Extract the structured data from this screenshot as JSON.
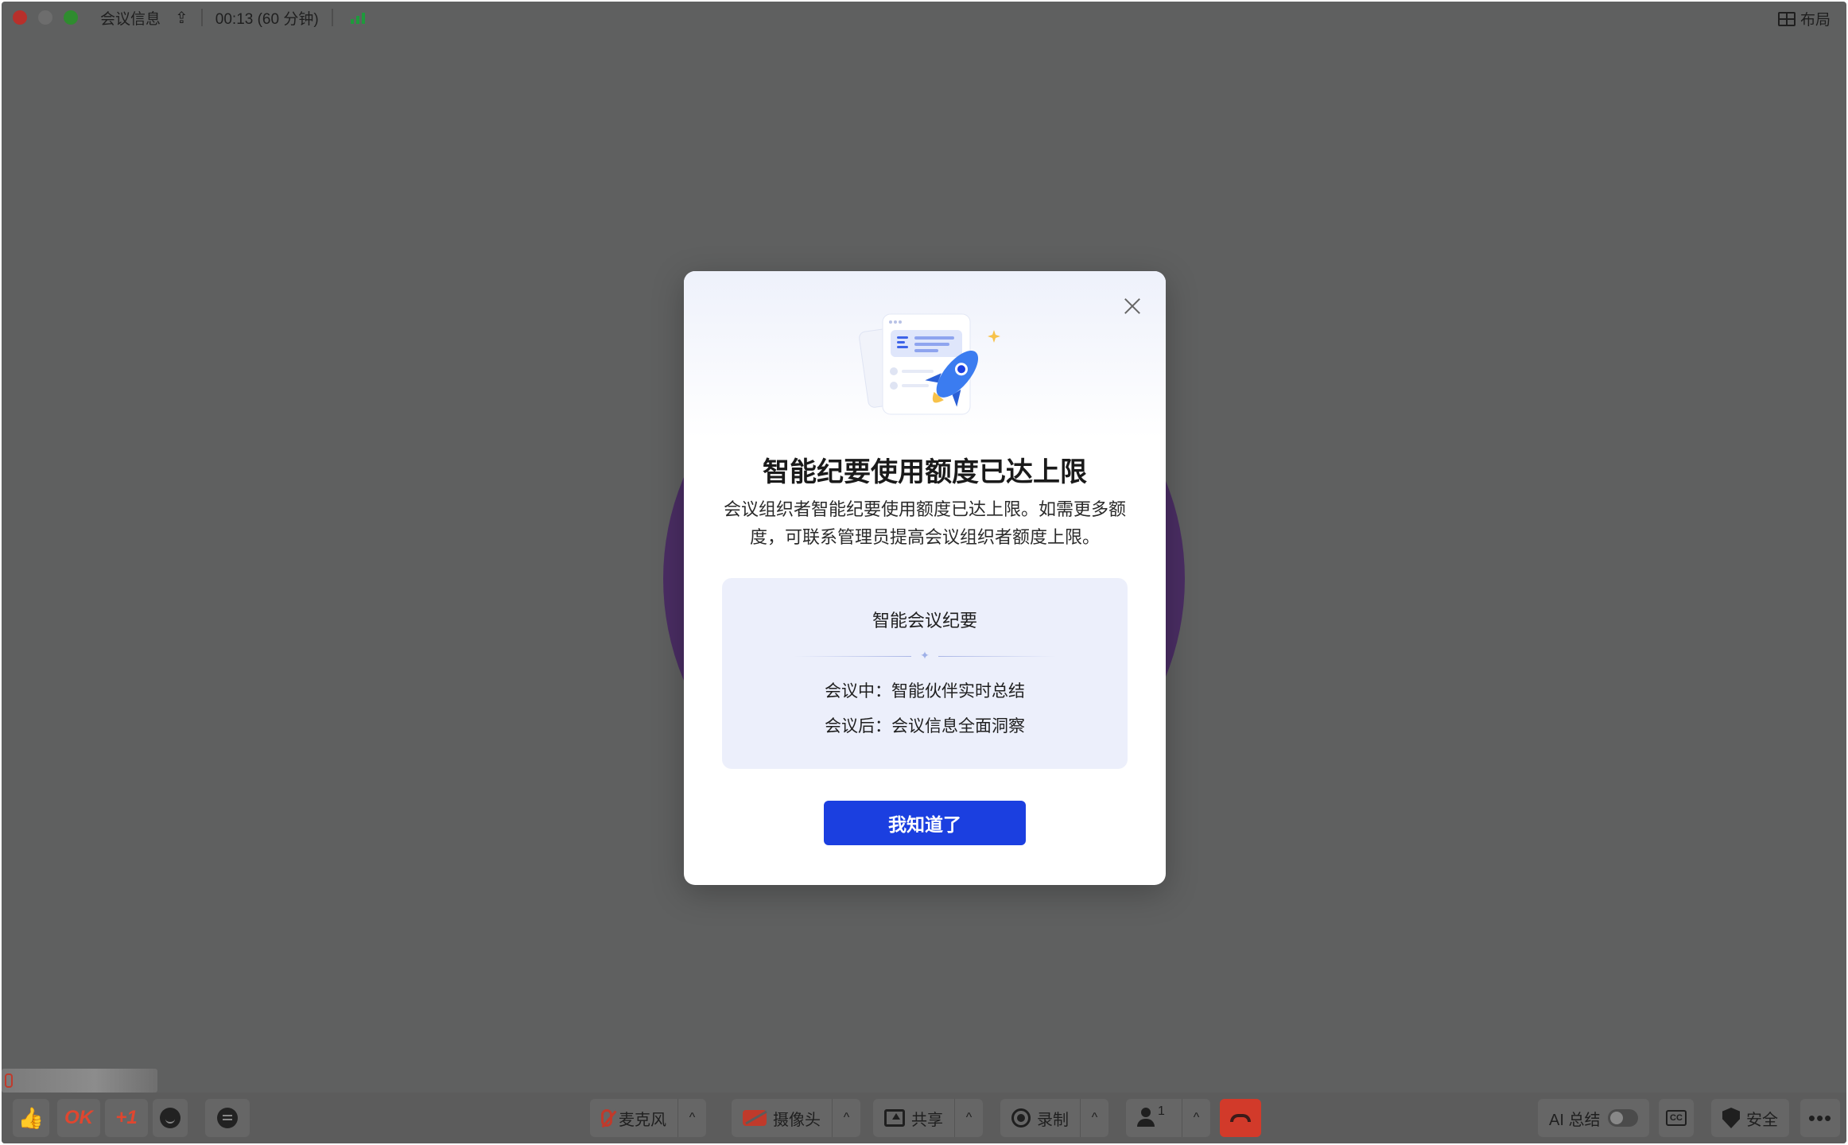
{
  "titlebar": {
    "meeting_info": "会议信息",
    "timer": "00:13 (60 分钟)",
    "layout_label": "布局"
  },
  "toolbar": {
    "reactions": {
      "ok": "OK",
      "plus_one": "+1"
    },
    "mic_label": "麦克风",
    "camera_label": "摄像头",
    "share_label": "共享",
    "record_label": "录制",
    "participants_count": "1",
    "ai_summary_label": "AI 总结",
    "cc_label": "CC",
    "security_label": "安全",
    "more_label": "•••",
    "caret": "^"
  },
  "modal": {
    "title": "智能纪要使用额度已达上限",
    "description": "会议组织者智能纪要使用额度已达上限。如需更多额度，可联系管理员提高会议组织者额度上限。",
    "feature_box": {
      "title": "智能会议纪要",
      "items": [
        "会议中：智能伙伴实时总结",
        "会议后：会议信息全面洞察"
      ]
    },
    "confirm_button": "我知道了"
  },
  "colors": {
    "accent": "#1b3fe0",
    "hangup": "#d23a2a",
    "avatar_bg": "#4a2d63",
    "mic_off": "#c03a2b"
  }
}
